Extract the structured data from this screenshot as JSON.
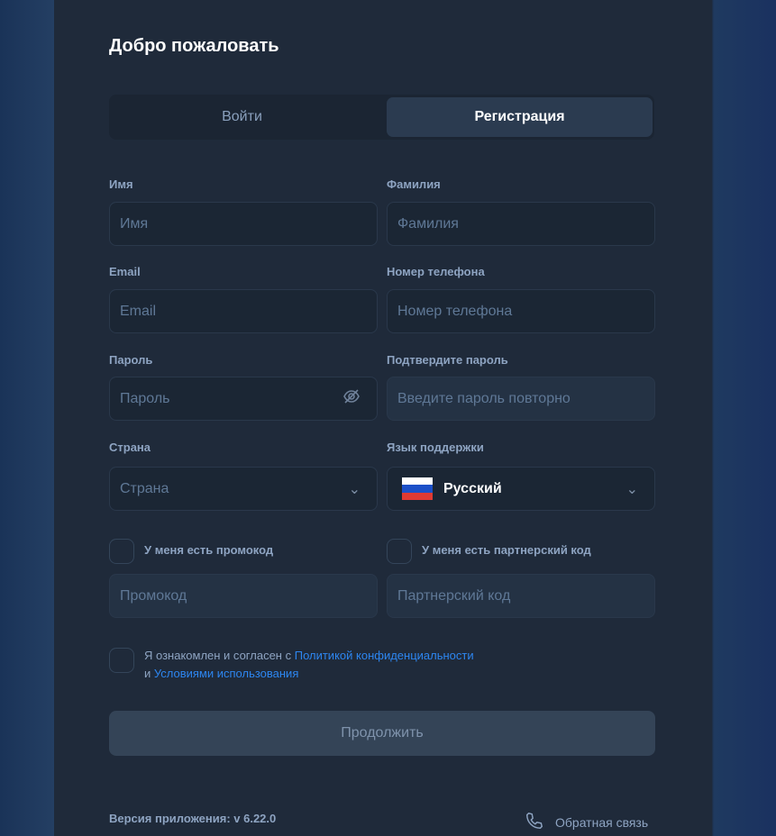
{
  "title": "Добро пожаловать",
  "tabs": {
    "login": "Войти",
    "register": "Регистрация"
  },
  "fields": {
    "first_name": {
      "label": "Имя",
      "placeholder": "Имя"
    },
    "last_name": {
      "label": "Фамилия",
      "placeholder": "Фамилия"
    },
    "email": {
      "label": "Email",
      "placeholder": "Email"
    },
    "phone": {
      "label": "Номер телефона",
      "placeholder": "Номер телефона"
    },
    "password": {
      "label": "Пароль",
      "placeholder": "Пароль"
    },
    "confirm": {
      "label": "Подтвердите пароль",
      "placeholder": "Введите пароль повторно"
    },
    "country": {
      "label": "Страна",
      "placeholder": "Страна"
    },
    "language": {
      "label": "Язык поддержки",
      "value": "Русский"
    },
    "promo": {
      "checkbox": "У меня есть промокод",
      "placeholder": "Промокод"
    },
    "partner": {
      "checkbox": "У меня есть партнерский код",
      "placeholder": "Партнерский код"
    }
  },
  "agree": {
    "text1": "Я ознакомлен и согласен с ",
    "link1": "Политикой конфиденциальности",
    "text2": "и ",
    "link2": "Условиями использования"
  },
  "continue": "Продолжить",
  "footer": {
    "version": "Версия приложения: v 6.22.0",
    "feedback": "Обратная связь"
  }
}
